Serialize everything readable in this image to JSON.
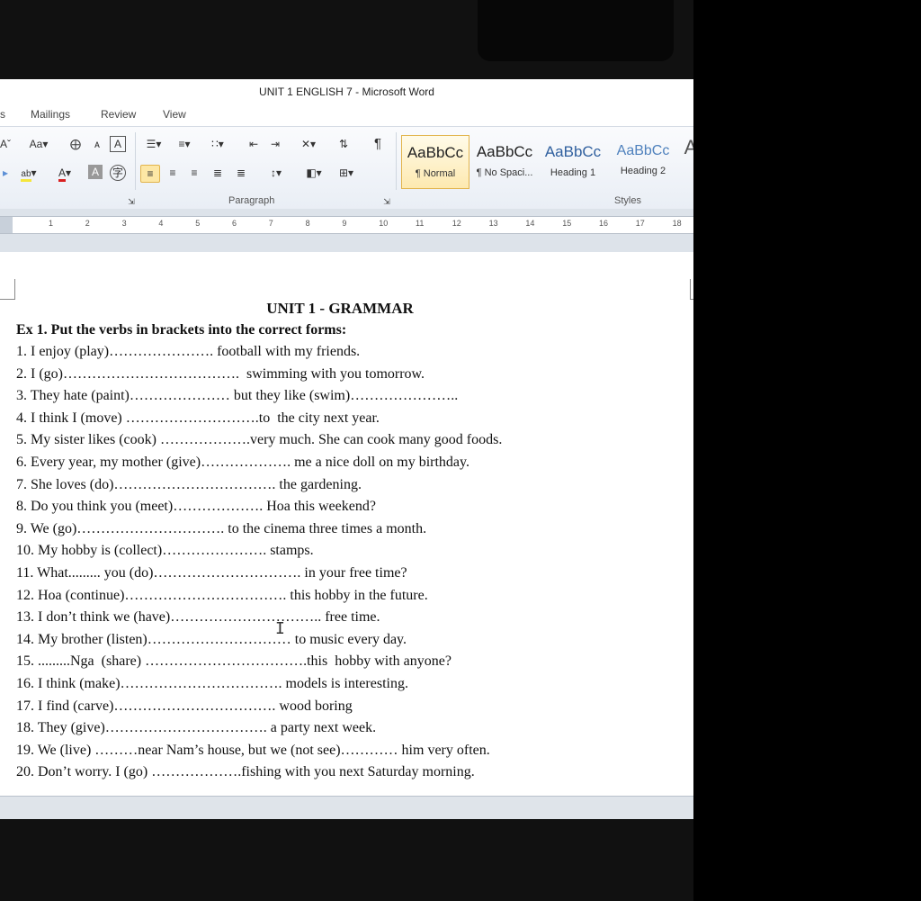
{
  "window": {
    "title": "UNIT 1 ENGLISH 7 - Microsoft Word"
  },
  "tabs": {
    "partial": "s",
    "mailings": "Mailings",
    "review": "Review",
    "view": "View"
  },
  "ribbon": {
    "font_case": "Aa",
    "paragraph_label": "Paragraph",
    "styles_label": "Styles",
    "pilcrow": "¶",
    "styles": [
      {
        "sample": "AaBbCc",
        "name": "¶ Normal"
      },
      {
        "sample": "AaBbCc",
        "name": "¶ No Spaci..."
      },
      {
        "sample": "AaBbCc",
        "name": "Heading 1"
      },
      {
        "sample": "AaBbCc",
        "name": "Heading 2"
      }
    ]
  },
  "ruler": {
    "numbers": [
      "1",
      "2",
      "3",
      "4",
      "5",
      "6",
      "7",
      "8",
      "9",
      "10",
      "11",
      "12",
      "13",
      "14",
      "15",
      "16",
      "17",
      "18"
    ]
  },
  "document": {
    "title": "UNIT 1 - GRAMMAR",
    "exercise_title": "Ex 1. Put the verbs in brackets into the correct forms:",
    "lines": [
      "1. I enjoy (play)…………………. football with my friends.",
      "2. I (go)……………………………….  swimming with you tomorrow.",
      "3. They hate (paint)………………… but they like (swim)…………………..",
      "4. I think I (move) ……………………….to  the city next year.",
      "5. My sister likes (cook) ……………….very much. She can cook many good foods.",
      "6. Every year, my mother (give)………………. me a nice doll on my birthday.",
      "7. She loves (do)……………………………. the gardening.",
      "8. Do you think you (meet)………………. Hoa this weekend?",
      "9. We (go)…………………………. to the cinema three times a month.",
      "10. My hobby is (collect)…………………. stamps.",
      "11. What......... you (do)…………………………. in your free time?",
      "12. Hoa (continue)……………………………. this hobby in the future.",
      "13. I don’t think we (have)………………………….. free time.",
      "14. My brother (listen)………………………… to music every day.",
      "15. .........Nga  (share) …………………………….this  hobby with anyone?",
      "16. I think (make)……………………………. models is interesting.",
      "17. I find (carve)……………………………. wood boring",
      "18. They (give)……………………………. a party next week.",
      "19. We (live) ………near Nam’s house, but we (not see)………… him very often.",
      "20. Don’t worry. I (go) ……………….fishing with you next Saturday morning."
    ]
  },
  "colors": {
    "highlight": "#f5e63b",
    "font_color": "#d92020",
    "selected_style": "#fde9b0"
  }
}
